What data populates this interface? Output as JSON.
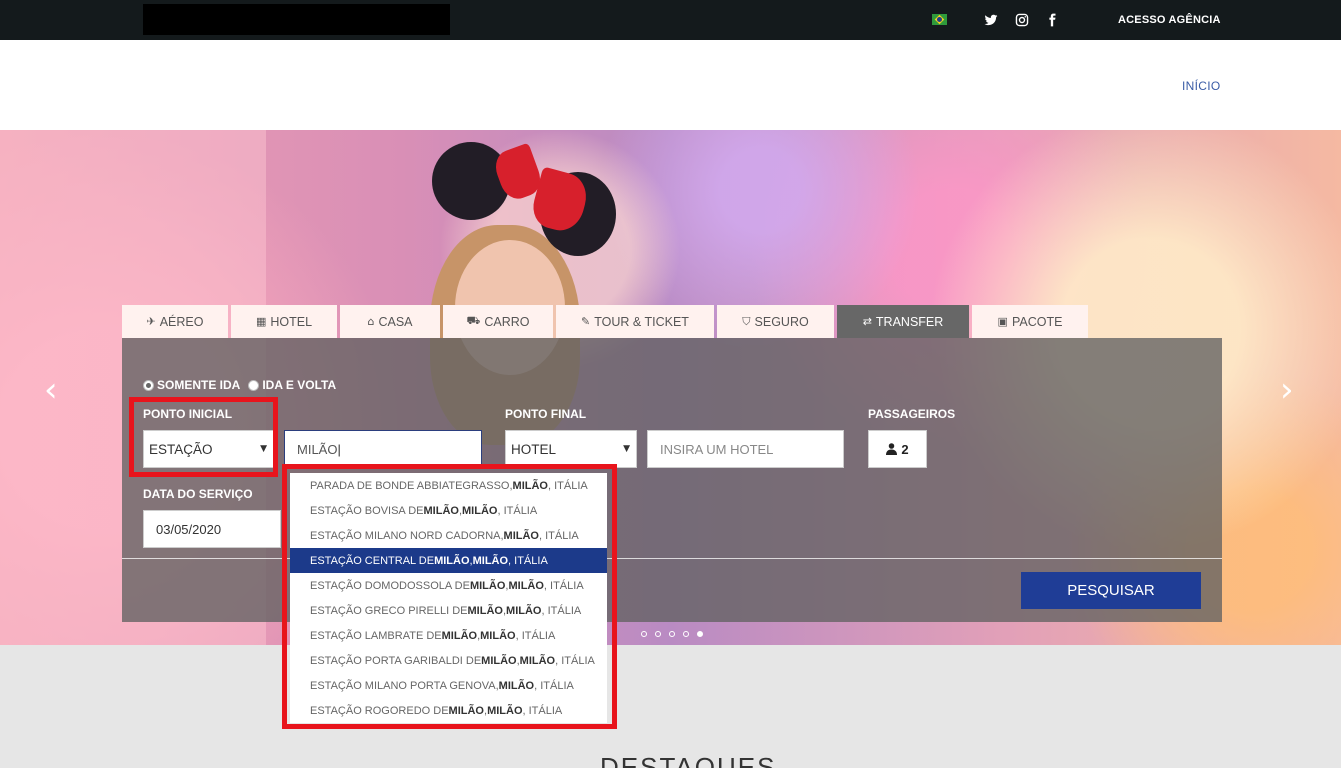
{
  "topbar": {
    "acesso_label": "ACESSO AGÊNCIA",
    "social": [
      "twitter-icon",
      "instagram-icon",
      "facebook-icon"
    ],
    "flag": "brazil-flag-icon"
  },
  "header": {
    "nav_inicio": "INÍCIO"
  },
  "tabs": [
    {
      "label": "AÉREO",
      "icon": "✈"
    },
    {
      "label": "HOTEL",
      "icon": "▦"
    },
    {
      "label": "CASA",
      "icon": "⌂"
    },
    {
      "label": "CARRO",
      "icon": "⛟"
    },
    {
      "label": "TOUR & TICKET",
      "icon": "✎"
    },
    {
      "label": "SEGURO",
      "icon": "⛉"
    },
    {
      "label": "TRANSFER",
      "icon": "⇄"
    },
    {
      "label": "PACOTE",
      "icon": "▣"
    }
  ],
  "form": {
    "trip_type": {
      "option1": "SOMENTE IDA",
      "option2": "IDA E VOLTA",
      "selected": "SOMENTE IDA"
    },
    "ponto_inicial_label": "PONTO INICIAL",
    "ponto_inicial_type": "ESTAÇÃO",
    "ponto_inicial_value": "MILÃO",
    "ponto_final_label": "PONTO FINAL",
    "ponto_final_type": "HOTEL",
    "ponto_final_placeholder": "INSIRA UM HOTEL",
    "passageiros_label": "PASSAGEIROS",
    "passageiros_value": "2",
    "data_label": "DATA DO SERVIÇO",
    "data_value": "03/05/2020",
    "search_button": "PESQUISAR"
  },
  "dropdown": [
    {
      "pre": "PARADA DE BONDE ABBIATEGRASSO, ",
      "b1": "MILÃO",
      "mid": ", ITÁLIA",
      "b2": "",
      "post": ""
    },
    {
      "pre": "ESTAÇÃO BOVISA DE ",
      "b1": "MILÃO",
      "mid": ", ",
      "b2": "MILÃO",
      "post": ", ITÁLIA"
    },
    {
      "pre": "ESTAÇÃO MILANO NORD CADORNA, ",
      "b1": "MILÃO",
      "mid": ", ITÁLIA",
      "b2": "",
      "post": ""
    },
    {
      "pre": "ESTAÇÃO CENTRAL DE ",
      "b1": "MILÃO",
      "mid": ", ",
      "b2": "MILÃO",
      "post": ", ITÁLIA"
    },
    {
      "pre": "ESTAÇÃO DOMODOSSOLA DE ",
      "b1": "MILÃO",
      "mid": ", ",
      "b2": "MILÃO",
      "post": ", ITÁLIA"
    },
    {
      "pre": "ESTAÇÃO GRECO PIRELLI DE ",
      "b1": "MILÃO",
      "mid": ", ",
      "b2": "MILÃO",
      "post": ", ITÁLIA"
    },
    {
      "pre": "ESTAÇÃO LAMBRATE DE ",
      "b1": "MILÃO",
      "mid": ", ",
      "b2": "MILÃO",
      "post": ", ITÁLIA"
    },
    {
      "pre": "ESTAÇÃO PORTA GARIBALDI DE ",
      "b1": "MILÃO",
      "mid": ", ",
      "b2": "MILÃO",
      "post": ", ITÁLIA"
    },
    {
      "pre": "ESTAÇÃO MILANO PORTA GENOVA, ",
      "b1": "MILÃO",
      "mid": ", ITÁLIA",
      "b2": "",
      "post": ""
    },
    {
      "pre": "ESTAÇÃO ROGOREDO DE ",
      "b1": "MILÃO",
      "mid": ", ",
      "b2": "MILÃO",
      "post": ", ITÁLIA"
    }
  ],
  "dropdown_highlight_index": 3,
  "carousel": {
    "prev": "‹",
    "next": "›",
    "slides": 5,
    "active": 4
  },
  "section_title": "DESTAQUES",
  "colors": {
    "topbar": "#141a1c",
    "accent": "#1f3d96",
    "highlight": "#1c3a8a",
    "annotation": "#e8141c"
  }
}
